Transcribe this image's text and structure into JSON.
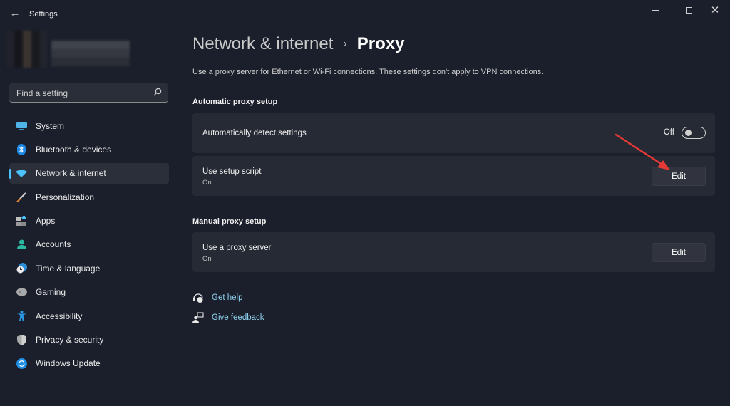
{
  "window": {
    "title": "Settings",
    "controls": {
      "minimize": "minimize",
      "maximize": "maximize",
      "close": "close"
    }
  },
  "search": {
    "placeholder": "Find a setting"
  },
  "sidebar": {
    "items": [
      {
        "label": "System",
        "icon": "monitor-icon"
      },
      {
        "label": "Bluetooth & devices",
        "icon": "bluetooth-icon"
      },
      {
        "label": "Network & internet",
        "icon": "wifi-icon",
        "active": true
      },
      {
        "label": "Personalization",
        "icon": "brush-icon"
      },
      {
        "label": "Apps",
        "icon": "apps-icon"
      },
      {
        "label": "Accounts",
        "icon": "person-icon"
      },
      {
        "label": "Time & language",
        "icon": "clock-globe-icon"
      },
      {
        "label": "Gaming",
        "icon": "gamepad-icon"
      },
      {
        "label": "Accessibility",
        "icon": "accessibility-icon"
      },
      {
        "label": "Privacy & security",
        "icon": "shield-icon"
      },
      {
        "label": "Windows Update",
        "icon": "update-icon"
      }
    ]
  },
  "header": {
    "parent": "Network & internet",
    "separator": "›",
    "current": "Proxy",
    "description": "Use a proxy server for Ethernet or Wi-Fi connections. These settings don't apply to VPN connections."
  },
  "automatic": {
    "heading": "Automatic proxy setup",
    "detect": {
      "title": "Automatically detect settings",
      "state_label": "Off",
      "on": false
    },
    "script": {
      "title": "Use setup script",
      "status": "On",
      "button": "Edit"
    }
  },
  "manual": {
    "heading": "Manual proxy setup",
    "proxy": {
      "title": "Use a proxy server",
      "status": "On",
      "button": "Edit"
    }
  },
  "links": {
    "help": "Get help",
    "feedback": "Give feedback"
  },
  "colors": {
    "accent": "#4cc2ff",
    "link": "#8fd3f0",
    "annotation_arrow": "#e53935"
  }
}
